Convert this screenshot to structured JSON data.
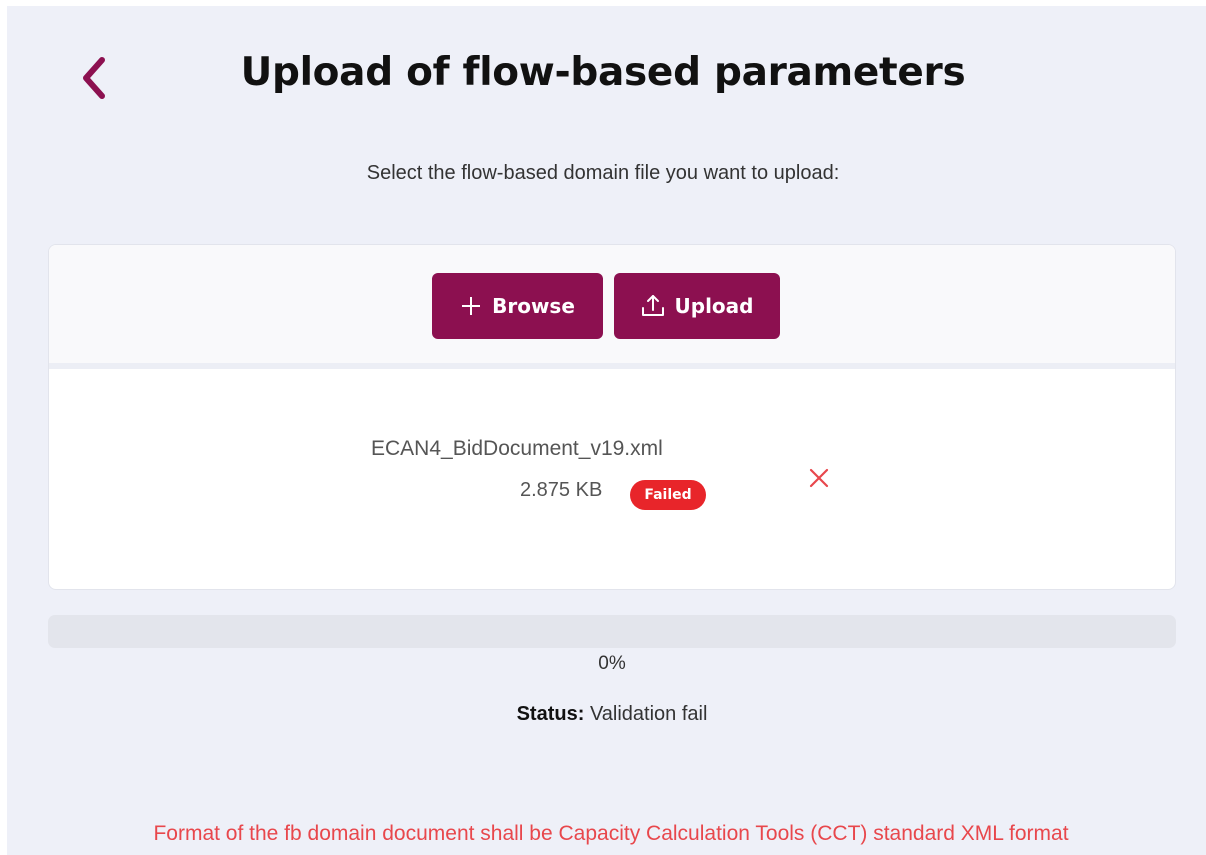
{
  "header": {
    "back_icon": "chevron-left-icon",
    "title": "Upload of flow-based parameters"
  },
  "instruction": "Select the flow-based domain file you want to upload:",
  "toolbar": {
    "browse_label": "Browse",
    "browse_icon": "plus-icon",
    "upload_label": "Upload",
    "upload_icon": "upload-icon"
  },
  "file": {
    "name": "ECAN4_BidDocument_v19.xml",
    "size": "2.875 KB",
    "status_badge": "Failed",
    "remove_icon": "close-icon"
  },
  "progress": {
    "value_percent": 0,
    "label": "0%"
  },
  "status": {
    "key": "Status:",
    "value": "Validation fail"
  },
  "note": "Format of the fb domain document shall be Capacity Calculation Tools (CCT) standard XML format",
  "colors": {
    "accent": "#8c1050",
    "error": "#e8252a",
    "note": "#e8474c",
    "background": "#eef0f8"
  }
}
